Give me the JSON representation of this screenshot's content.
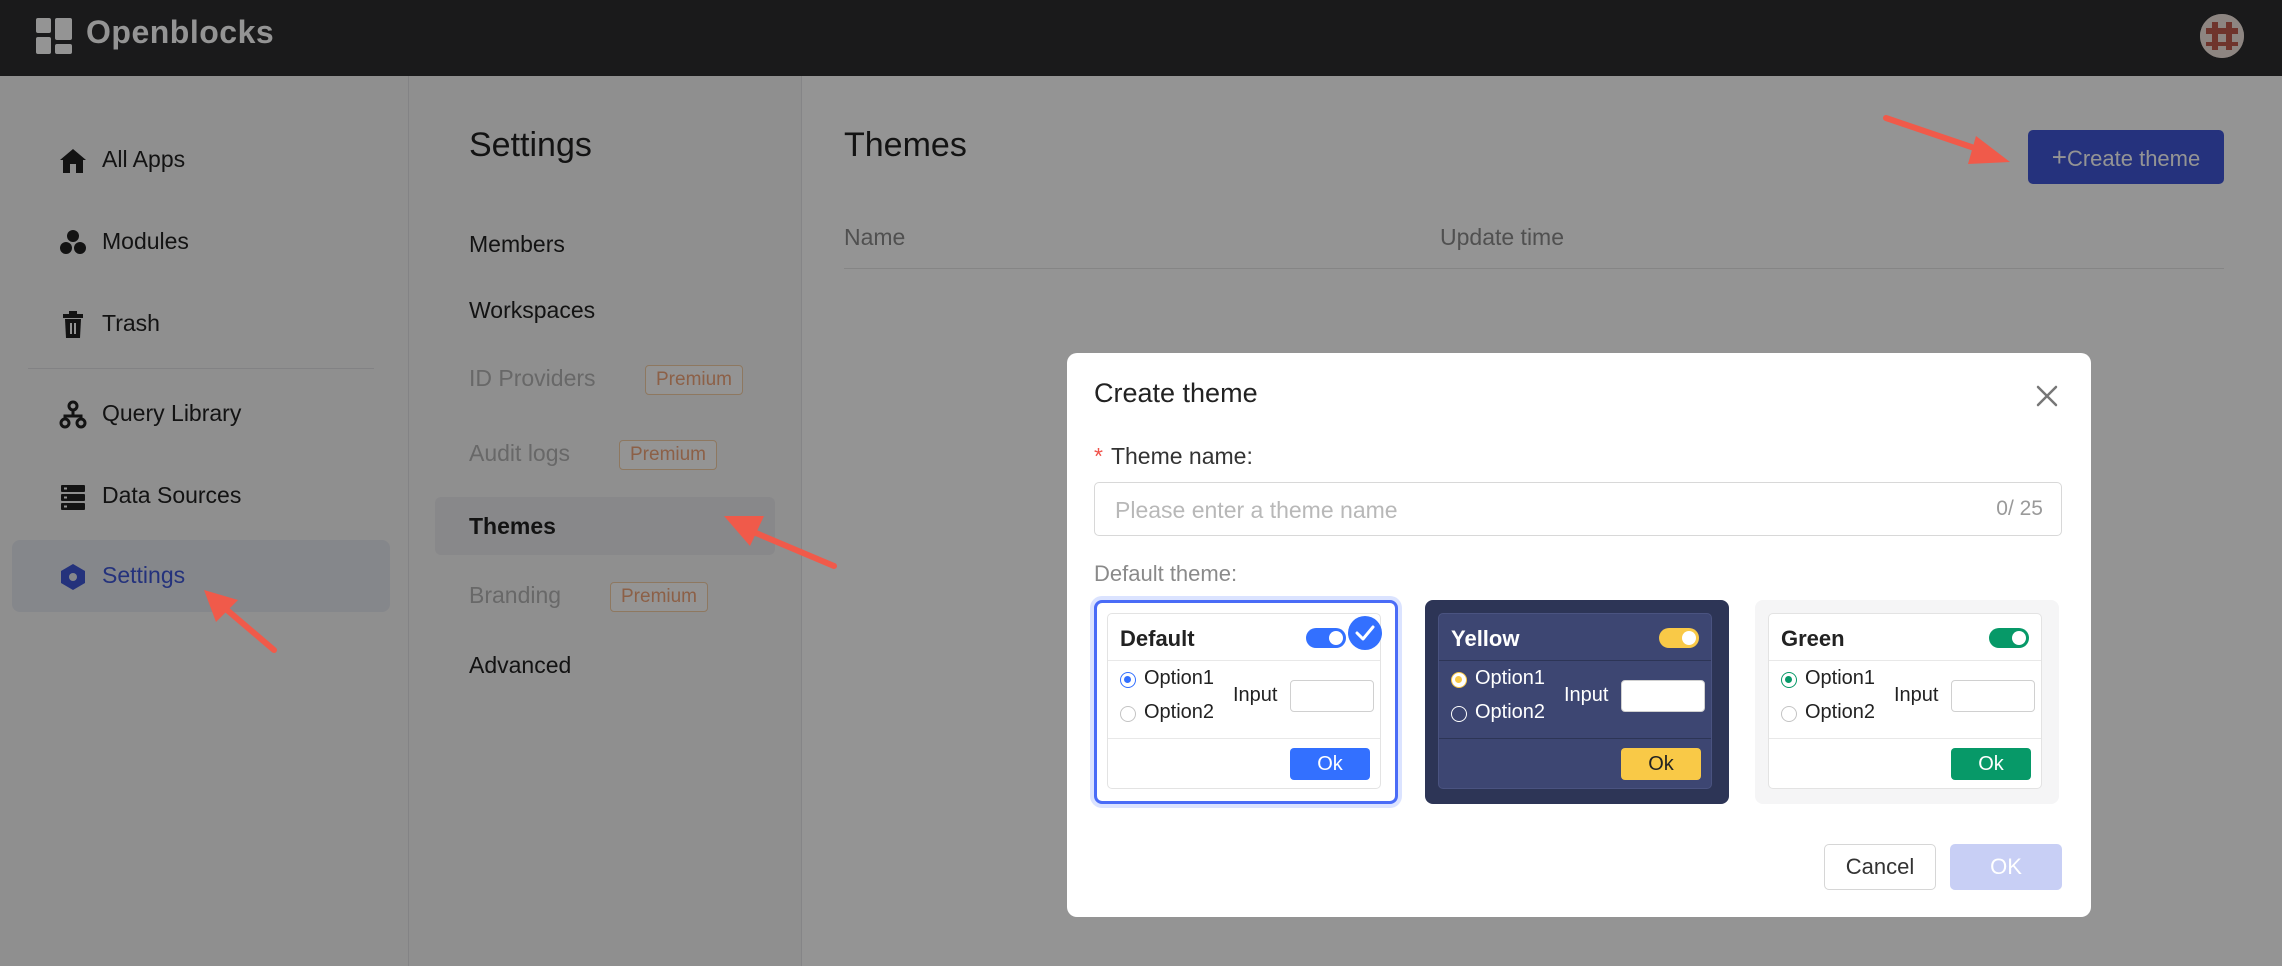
{
  "app": {
    "name": "Openblocks"
  },
  "nav": {
    "items": [
      {
        "label": "All Apps",
        "icon": "home-icon"
      },
      {
        "label": "Modules",
        "icon": "modules-icon"
      },
      {
        "label": "Trash",
        "icon": "trash-icon"
      },
      {
        "label": "Query Library",
        "icon": "query-library-icon"
      },
      {
        "label": "Data Sources",
        "icon": "data-sources-icon"
      },
      {
        "label": "Settings",
        "icon": "settings-hexagon-icon",
        "active": true
      }
    ]
  },
  "settings": {
    "title": "Settings",
    "items": [
      {
        "label": "Members"
      },
      {
        "label": "Workspaces"
      },
      {
        "label": "ID Providers",
        "badge": "Premium",
        "disabled": true
      },
      {
        "label": "Audit logs",
        "badge": "Premium",
        "disabled": true
      },
      {
        "label": "Themes",
        "active": true
      },
      {
        "label": "Branding",
        "badge": "Premium",
        "disabled": true
      },
      {
        "label": "Advanced"
      }
    ]
  },
  "main": {
    "title": "Themes",
    "create_button": "Create theme",
    "columns": [
      "Name",
      "Update time"
    ]
  },
  "modal": {
    "title": "Create theme",
    "name_label": "Theme name:",
    "name_placeholder": "Please enter a theme name",
    "name_counter": "0/ 25",
    "default_label": "Default theme:",
    "themes": [
      {
        "name": "Default",
        "option1": "Option1",
        "option2": "Option2",
        "input_label": "Input",
        "ok": "Ok",
        "accent": "#3370ff",
        "selected": true
      },
      {
        "name": "Yellow",
        "option1": "Option1",
        "option2": "Option2",
        "input_label": "Input",
        "ok": "Ok",
        "accent": "#f9c947"
      },
      {
        "name": "Green",
        "option1": "Option1",
        "option2": "Option2",
        "input_label": "Input",
        "ok": "Ok",
        "accent": "#079968"
      }
    ],
    "cancel": "Cancel",
    "ok": "OK"
  },
  "colors": {
    "brand": "#4056d8",
    "annotation_arrow": "#f05a4a"
  }
}
